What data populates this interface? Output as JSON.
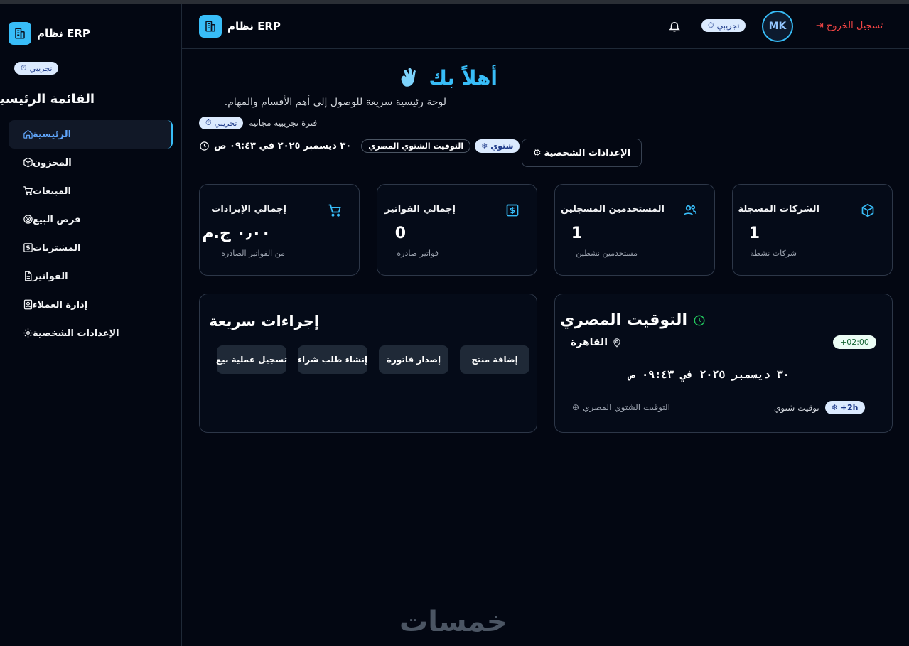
{
  "brand": {
    "name": "نظام ERP",
    "trial_badge": "تجريبي"
  },
  "sidebar": {
    "title": "القائمة الرئيسية",
    "items": [
      {
        "label": "الرئيسية",
        "icon": "home-icon",
        "active": true
      },
      {
        "label": "المخزون",
        "icon": "box-icon"
      },
      {
        "label": "المبيعات",
        "icon": "cart-icon"
      },
      {
        "label": "فرص البيع",
        "icon": "target-icon"
      },
      {
        "label": "المشتريات",
        "icon": "dollar-icon"
      },
      {
        "label": "الفواتير",
        "icon": "file-icon"
      },
      {
        "label": "إدارة العملاء",
        "icon": "user-card-icon"
      },
      {
        "label": "الإعدادات الشخصية",
        "icon": "gear-icon"
      }
    ]
  },
  "header": {
    "brand": "نظام ERP",
    "trial_badge": "تجريبي",
    "avatar_initials": "MK",
    "logout_label": "تسجيل الخروج"
  },
  "welcome": {
    "title": "أهلاً بك",
    "subtitle": "لوحة رئيسية سريعة للوصول إلى أهم الأقسام والمهام.",
    "trial_text": "فترة تجريبية مجانية",
    "trial_badge": "تجريبي",
    "datetime": "٣٠ ديسمبر ٢٠٢٥ في ٠٩:٤٣ ص",
    "timezone_chip": "التوقيت الشتوي المصري",
    "season_chip": "شتوي",
    "settings_label": "الإعدادات الشخصية"
  },
  "stats": [
    {
      "title": "الشركات المسجلة",
      "value": "1",
      "sub": "شركات نشطة",
      "icon": "box-icon"
    },
    {
      "title": "المستخدمين المسجلين",
      "value": "1",
      "sub": "مستخدمين نشطين",
      "icon": "users-icon"
    },
    {
      "title": "إجمالي الفواتير",
      "value": "0",
      "sub": "فواتير صادرة",
      "icon": "invoice-icon"
    },
    {
      "title": "إجمالي الإيرادات",
      "value": "٠٫٠٠ ج.م",
      "sub": "من الفواتير الصادرة",
      "icon": "cart-icon"
    }
  ],
  "quick_actions": {
    "title": "إجراءات سريعة",
    "buttons": [
      "إضافة منتج",
      "إصدار فاتورة",
      "إنشاء طلب شراء",
      "تسجيل عملية بيع"
    ]
  },
  "egypt_time": {
    "title": "التوقيت المصري",
    "city": "القاهرة",
    "offset": "+02:00",
    "datetime": "٣٠ ديسمبر ٢٠٢٥ في ٠٩:٤٣ ص",
    "winter_label": "توقيت شتوي",
    "winter_chip": "+2h",
    "zone_label": "التوقيت الشتوي المصري"
  },
  "watermark": "خمسات",
  "colors": {
    "accent": "#38bdf8",
    "background": "#030712",
    "logout": "#ef4444",
    "card_border": "#2d3748"
  }
}
